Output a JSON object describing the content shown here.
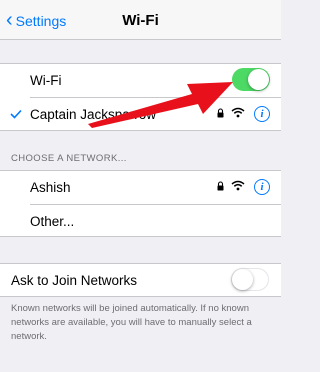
{
  "navbar": {
    "back_label": "Settings",
    "title": "Wi-Fi"
  },
  "wifi_toggle": {
    "label": "Wi-Fi",
    "on": true
  },
  "connected": {
    "network": "Captain Jacksparrow"
  },
  "choose": {
    "header": "CHOOSE A NETWORK...",
    "networks": [
      "Ashish"
    ],
    "other": "Other..."
  },
  "ask_join": {
    "label": "Ask to Join Networks",
    "on": false
  },
  "footer": {
    "text": "Known networks will be joined automatically. If no known networks are available, you will have to manually select a network."
  },
  "colors": {
    "accent": "#007aff",
    "toggle_on": "#4cd964",
    "annotation_arrow": "#e8101a"
  },
  "icons": [
    "chevron-left-icon",
    "checkmark-icon",
    "lock-icon",
    "wifi-icon",
    "info-icon",
    "red-arrow-annotation"
  ]
}
